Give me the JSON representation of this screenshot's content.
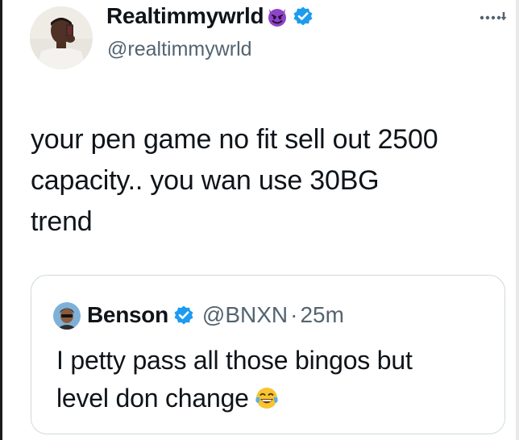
{
  "tweet": {
    "author": {
      "display_name": "Realtimmywrld",
      "handle": "@realtimmywrld",
      "name_emoji": "smiling-devil-emoji",
      "verified": true,
      "avatar": "avatar-photo"
    },
    "more_icon": "more-dots-icon",
    "text": "your pen game no fit sell out 2500\ncapacity.. you wan use 30BG\ntrend"
  },
  "quote": {
    "author": {
      "display_name": "Benson",
      "handle": "@BNXN",
      "separator": "·",
      "time": "25m",
      "verified": true,
      "avatar": "avatar-cartoon"
    },
    "text": "I petty pass all those bingos but\nlevel don change",
    "trailing_emoji": "tears-of-joy-emoji"
  },
  "colors": {
    "text": "#0f1419",
    "secondary": "#536471",
    "verified": "#1d9bf0",
    "border": "#cfd9de",
    "devil": "#8e44c9"
  }
}
